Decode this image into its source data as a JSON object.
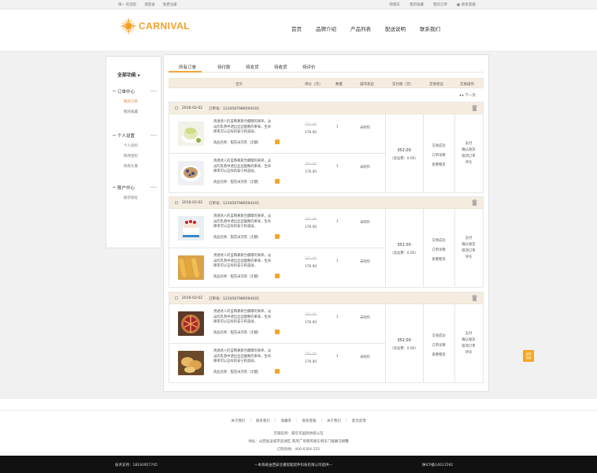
{
  "topbar": {
    "left": [
      "嗨~ 欢迎您",
      "请登录",
      "免费注册"
    ],
    "right": [
      "购物车",
      "我的收藏",
      "我的订单",
      "联系客服"
    ]
  },
  "brand": {
    "name": "CARNIVAL",
    "color": "#f0a028"
  },
  "nav": [
    "首页",
    "品牌介绍",
    "产品列表",
    "配送说明",
    "联系我们"
  ],
  "sidebar": {
    "title": "全部功能",
    "groups": [
      {
        "title": "订单中心",
        "items": [
          "我的订单",
          "我的收藏"
        ]
      },
      {
        "title": "个人设置",
        "items": [
          "个人资料",
          "修改密码",
          "修改头像"
        ]
      },
      {
        "title": "账户中心",
        "items": [
          "收货地址"
        ]
      }
    ]
  },
  "tabs": [
    "所有订单",
    "待付款",
    "待发货",
    "待收货",
    "待评价"
  ],
  "table_head": [
    "宝贝",
    "单价（元）",
    "数量",
    "操作状态",
    "实付款（元）",
    "交易状态",
    "交易操作"
  ],
  "pager": "下一页",
  "orders": [
    {
      "date": "2016-02-02",
      "order_no": "订单号：1234567989594165",
      "products": [
        {
          "desc": "清透诱人的蓝莓慕斯合麟摩的果卑，淡淡的乳香中透出丝丝酸数的果味，生命肆来可以这样的安宁和美丽。",
          "spec": "商品名称：甜花米苏卷（无糖）",
          "old_price": "181.00",
          "price": "176.00",
          "qty": "1",
          "op": "未制作"
        },
        {
          "desc": "清透诱人的蓝莓慕斯合麟摩的果卑，淡淡的乳香中透出丝丝酸数的果味，生命肆来可以这样的安宁和美丽。",
          "spec": "商品名称：甜花米苏卷（无糖）",
          "old_price": "181.00",
          "price": "176.00",
          "qty": "1",
          "op": "未制作"
        }
      ],
      "paid": "352.00",
      "shipping": "（含运费：0.00）",
      "status": [
        "交易成功",
        "订单详情",
        "查看物流"
      ],
      "ops": [
        "支付",
        "确认收货",
        "取消订单",
        "评论"
      ]
    },
    {
      "date": "2016-02-02",
      "order_no": "订单号：1234567989594165",
      "products": [
        {
          "desc": "清透诱人的蓝莓慕斯合麟摩的果卑，淡淡的乳香中透出丝丝酸数的果味，生命肆来可以这样的安宁和美丽。",
          "spec": "商品名称：甜花米苏卷（无糖）",
          "old_price": "181.00",
          "price": "176.00",
          "qty": "1",
          "op": "未制作"
        },
        {
          "desc": "清透诱人的蓝莓慕斯合麟摩的果卑，淡淡的乳香中透出丝丝酸数的果味，生命肆来可以这样的安宁和美丽。",
          "spec": "商品名称：甜花米苏卷（无糖）",
          "old_price": "181.00",
          "price": "176.00",
          "qty": "1",
          "op": "未制作"
        }
      ],
      "paid": "352.00",
      "shipping": "（含运费：0.00）",
      "status": [
        "交易成功",
        "订单详情",
        "查看物流"
      ],
      "ops": [
        "支付",
        "确认收货",
        "取消订单",
        "评论"
      ]
    },
    {
      "date": "2016-02-02",
      "order_no": "订单号：1234567989594165",
      "products": [
        {
          "desc": "清透诱人的蓝莓慕斯合麟摩的果卑，淡淡的乳香中透出丝丝酸数的果味，生命肆来可以这样的安宁和美丽。",
          "spec": "商品名称：甜花米苏卷（无糖）",
          "old_price": "181.00",
          "price": "176.00",
          "qty": "1",
          "op": "未制作"
        },
        {
          "desc": "清透诱人的蓝莓慕斯合麟摩的果卑，淡淡的乳香中透出丝丝酸数的果味，生命肆来可以这样的安宁和美丽。",
          "spec": "商品名称：甜花米苏卷（无糖）",
          "old_price": "181.00",
          "price": "176.00",
          "qty": "1",
          "op": "未制作"
        }
      ],
      "paid": "352.00",
      "shipping": "（含运费：0.00）",
      "status": [
        "交易成功",
        "订单详情",
        "查看物流"
      ],
      "ops": [
        "支付",
        "确认收货",
        "取消订单",
        "评论"
      ]
    }
  ],
  "float_button": [
    "返回",
    "顶部"
  ],
  "footer": {
    "links": [
      "关于我们",
      "联系我们",
      "收藏夹",
      "联系客服",
      "关于我们",
      "意见反馈"
    ],
    "info": [
      "店铺名称：嘉年华国际烘焙公馆",
      "地址：山西省运城市盐湖区 南风广场南风路东侧东门报酬马顾馨",
      "订购热线：400-6364-555"
    ]
  },
  "bottombar": {
    "left": "技术支持：18192957745",
    "center": "—本系统由西安诠睿智能软件科技有限公司提供—",
    "right": "陕ICP备14011592"
  }
}
